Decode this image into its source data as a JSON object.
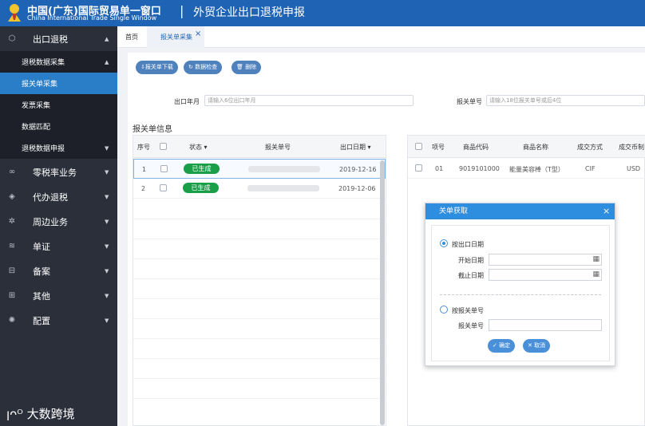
{
  "header": {
    "brand_main": "中国(广东)国际贸易单一窗口",
    "brand_sub": "China International Trade Single Window",
    "separator": "|",
    "title": "外贸企业出口退税申报"
  },
  "sidebar": {
    "top": {
      "label": "出口退税",
      "icon": "export-tax-icon"
    },
    "group": {
      "label": "退税数据采集"
    },
    "sub_items": [
      "报关单采集",
      "发票采集",
      "数据匹配"
    ],
    "group2": {
      "label": "退税数据申报"
    },
    "items": [
      {
        "label": "零税率业务",
        "icon": "zero-rate-icon"
      },
      {
        "label": "代办退税",
        "icon": "agent-tax-icon"
      },
      {
        "label": "周边业务",
        "icon": "peripheral-icon"
      },
      {
        "label": "单证",
        "icon": "documents-icon"
      },
      {
        "label": "备案",
        "icon": "filing-icon"
      },
      {
        "label": "其他",
        "icon": "grid-icon"
      },
      {
        "label": "配置",
        "icon": "gear-icon"
      }
    ],
    "footer_brand": "大数跨境"
  },
  "tabs": {
    "home": "首页",
    "active": "报关单采集",
    "close": "×"
  },
  "toolbar": {
    "download": "⇩报关单下载",
    "check": "数据检查",
    "delete": "删除"
  },
  "filters": {
    "export_month_label": "出口年月",
    "export_month_placeholder": "请输入6位出口年月",
    "declaration_no_label": "报关单号",
    "declaration_no_placeholder": "请输入18位报关单号或后4位"
  },
  "left_table": {
    "title": "报关单信息",
    "headers": {
      "seq": "序号",
      "status": "状态",
      "decl_no": "报关单号",
      "export_date": "出口日期"
    },
    "rows": [
      {
        "seq": "1",
        "status": "已生成",
        "export_date": "2019-12-16"
      },
      {
        "seq": "2",
        "status": "已生成",
        "export_date": "2019-12-06"
      }
    ]
  },
  "right_table": {
    "headers": {
      "item_no": "项号",
      "code": "商品代码",
      "name": "商品名称",
      "trade_mode": "成交方式",
      "currency": "成交币制"
    },
    "rows": [
      {
        "item_no": "01",
        "code": "9019101000",
        "name": "能量美容棒（T型）",
        "trade_mode": "CIF",
        "currency": "USD"
      }
    ]
  },
  "dialog": {
    "title": "关单获取",
    "close": "×",
    "option_date": "按出口日期",
    "start_date_label": "开始日期",
    "end_date_label": "截止日期",
    "option_decl": "按报关单号",
    "decl_label": "报关单号",
    "confirm": "确定",
    "cancel": "取消"
  },
  "colors": {
    "header": "#1f63b4",
    "sidebar": "#2b2f3a",
    "active_item": "#2a7ec8",
    "status_green": "#1a9e48",
    "dialog_header": "#2d8ee0"
  }
}
